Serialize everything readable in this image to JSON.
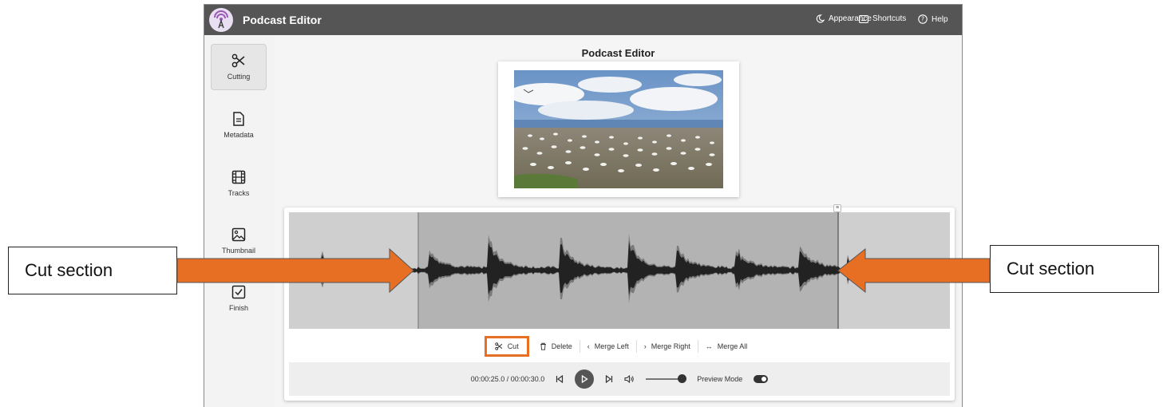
{
  "app": {
    "title": "Podcast Editor"
  },
  "topbar": {
    "appearance": "Appearance",
    "shortcuts": "Shortcuts",
    "help": "Help"
  },
  "sidebar": {
    "items": [
      {
        "label": "Cutting",
        "icon": "scissors-icon",
        "active": true
      },
      {
        "label": "Metadata",
        "icon": "document-icon",
        "active": false
      },
      {
        "label": "Tracks",
        "icon": "film-icon",
        "active": false
      },
      {
        "label": "Thumbnail",
        "icon": "image-icon",
        "active": false
      },
      {
        "label": "Finish",
        "icon": "checkbox-icon",
        "active": false
      }
    ]
  },
  "main": {
    "title": "Podcast Editor",
    "actions": {
      "cut": "Cut",
      "delete": "Delete",
      "merge_left": "Merge Left",
      "merge_right": "Merge Right",
      "merge_all": "Merge All"
    },
    "player": {
      "time": "00:00:25.0 / 00:00:30.0",
      "volume": 0.9,
      "preview_mode_label": "Preview Mode",
      "preview_mode_on": true
    }
  },
  "annotations": {
    "left": "Cut section",
    "right": "Cut section",
    "color": "#e76f24"
  },
  "colors": {
    "titlebar": "#555555",
    "accent": "#e76f24"
  }
}
